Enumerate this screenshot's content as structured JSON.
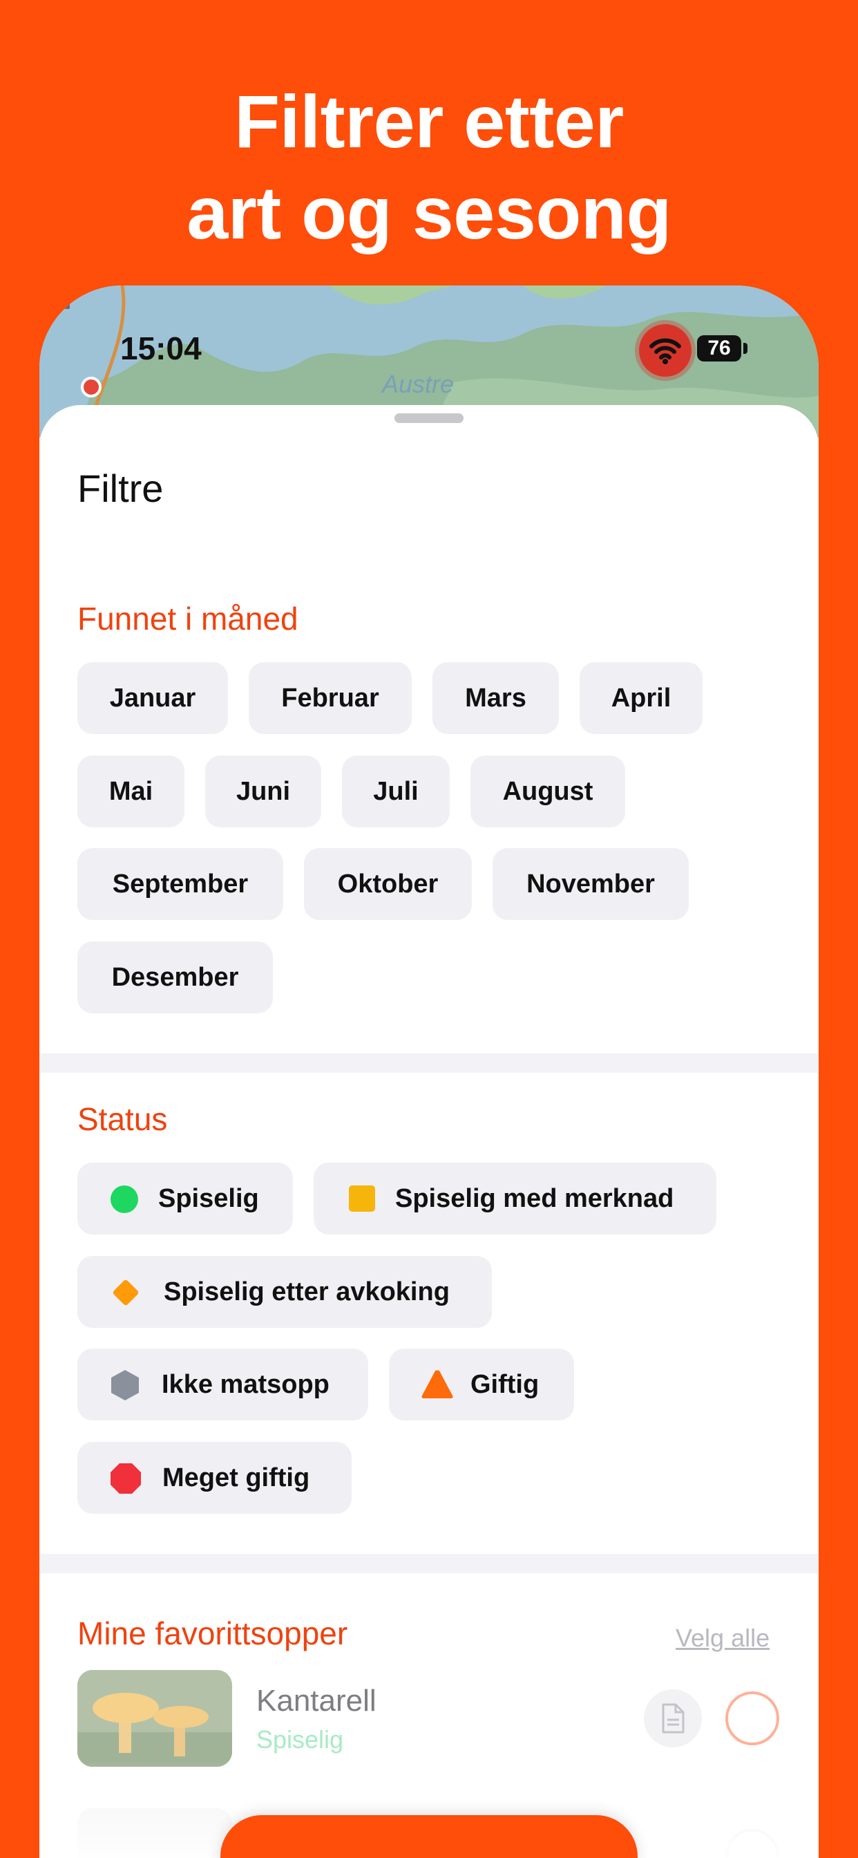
{
  "headline": {
    "line1": "Filtrer etter",
    "line2": "art og sesong"
  },
  "status_bar": {
    "time": "15:04",
    "battery": "76",
    "location_icon": "location-arrow-icon",
    "wifi_icon": "wifi-icon",
    "signal_icon": "cellular-signal-icon"
  },
  "map": {
    "label": "Austre"
  },
  "sheet": {
    "title": "Filtre"
  },
  "months": {
    "title": "Funnet i måned",
    "items": [
      "Januar",
      "Februar",
      "Mars",
      "April",
      "Mai",
      "Juni",
      "Juli",
      "August",
      "September",
      "Oktober",
      "November",
      "Desember"
    ]
  },
  "status": {
    "title": "Status",
    "items": [
      {
        "label": "Spiselig",
        "icon": "green-circle-icon",
        "color": "#1ED760"
      },
      {
        "label": "Spiselig med merknad",
        "icon": "yellow-square-icon",
        "color": "#F5B50A"
      },
      {
        "label": "Spiselig etter avkoking",
        "icon": "orange-diamond-icon",
        "color": "#FF9A0A"
      },
      {
        "label": "Ikke matsopp",
        "icon": "gray-hexagon-icon",
        "color": "#8A919C"
      },
      {
        "label": "Giftig",
        "icon": "orange-triangle-icon",
        "color": "#FF6A0A"
      },
      {
        "label": "Meget giftig",
        "icon": "red-octagon-icon",
        "color": "#F0303A"
      }
    ]
  },
  "favorites": {
    "title": "Mine favorittsopper",
    "select_all": "Velg alle",
    "items": [
      {
        "name": "Kantarell",
        "status": "Spiselig"
      }
    ]
  },
  "colors": {
    "accent": "#FF4D0A",
    "section_title": "#F0420E",
    "chip_bg": "#F0F0F4"
  }
}
